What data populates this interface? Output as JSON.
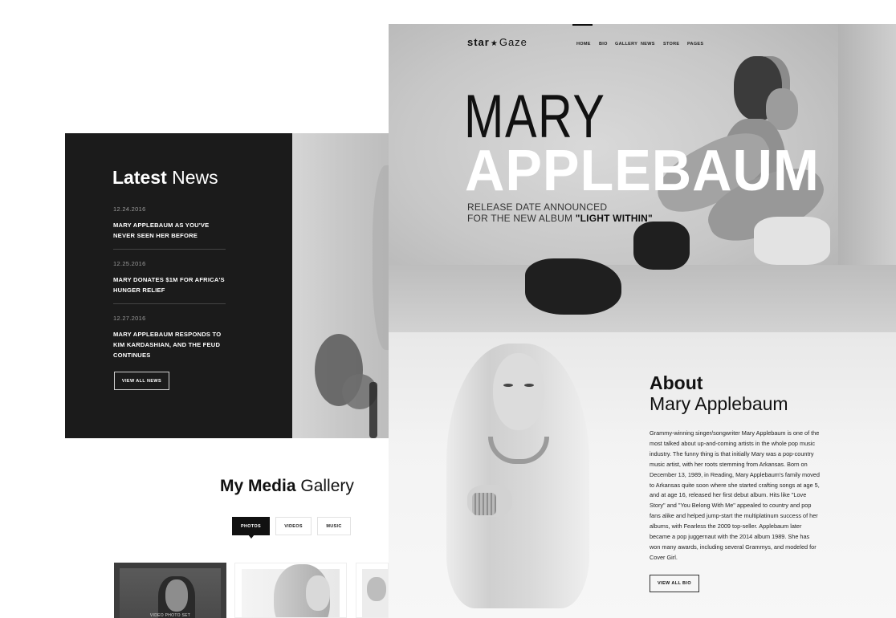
{
  "news": {
    "title_bold": "Latest",
    "title_light": "News",
    "items": [
      {
        "date": "12.24.2016",
        "headline": "MARY APPLEBAUM AS YOU'VE NEVER SEEN HER BEFORE"
      },
      {
        "date": "12.25.2016",
        "headline": "MARY DONATES $1M FOR AFRICA'S HUNGER RELIEF"
      },
      {
        "date": "12.27.2016",
        "headline": "MARY APPLEBAUM RESPONDS TO KIM KARDASHIAN, AND THE FEUD CONTINUES"
      }
    ],
    "button_label": "VIEW ALL NEWS"
  },
  "gallery": {
    "title_bold": "My Media",
    "title_light": "Gallery",
    "tabs": [
      {
        "label": "PHOTOS",
        "active": true
      },
      {
        "label": "VIDEOS",
        "active": false
      },
      {
        "label": "MUSIC",
        "active": false
      }
    ],
    "thumb_caption": "VIDEO PHOTO SET"
  },
  "header": {
    "logo_star": "star",
    "logo_gaze": "Gaze",
    "nav": [
      "HOME",
      "BIO",
      "GALLERY",
      "NEWS",
      "STORE",
      "PAGES"
    ],
    "active_nav": "HOME"
  },
  "hero": {
    "first_name": "MARY",
    "last_name": "APPLEBAUM",
    "subtitle_line1": "RELEASE DATE ANNOUNCED",
    "subtitle_line2_prefix": "FOR THE NEW ALBUM",
    "album": "\"LIGHT WITHIN\""
  },
  "about": {
    "heading": "About",
    "subheading": "Mary Applebaum",
    "body": "Grammy-winning singer/songwriter Mary Applebaum is one of the most talked about up-and-coming artists in the whole pop music industry. The funny thing is that initially Mary was a pop-country music artist, with her roots stemming from Arkansas. Born on December 13, 1989, in Reading, Mary Applebaum's family moved to Arkansas quite soon where she started crafting songs at age 5, and at age 16, released her first debut album. Hits like \"Love Story\" and \"You Belong With Me\" appealed to country and pop fans alike and helped jump-start the multiplatinum success of her albums, with Fearless the 2009 top-seller. Applebaum later became a pop juggernaut with the 2014 album 1989. She has won many awards, including several Grammys, and modeled for Cover Girl.",
    "button_label": "VIEW ALL BIO"
  },
  "colors": {
    "dark_panel": "#1b1b1b",
    "text_dark": "#111111",
    "text_white": "#ffffff"
  }
}
